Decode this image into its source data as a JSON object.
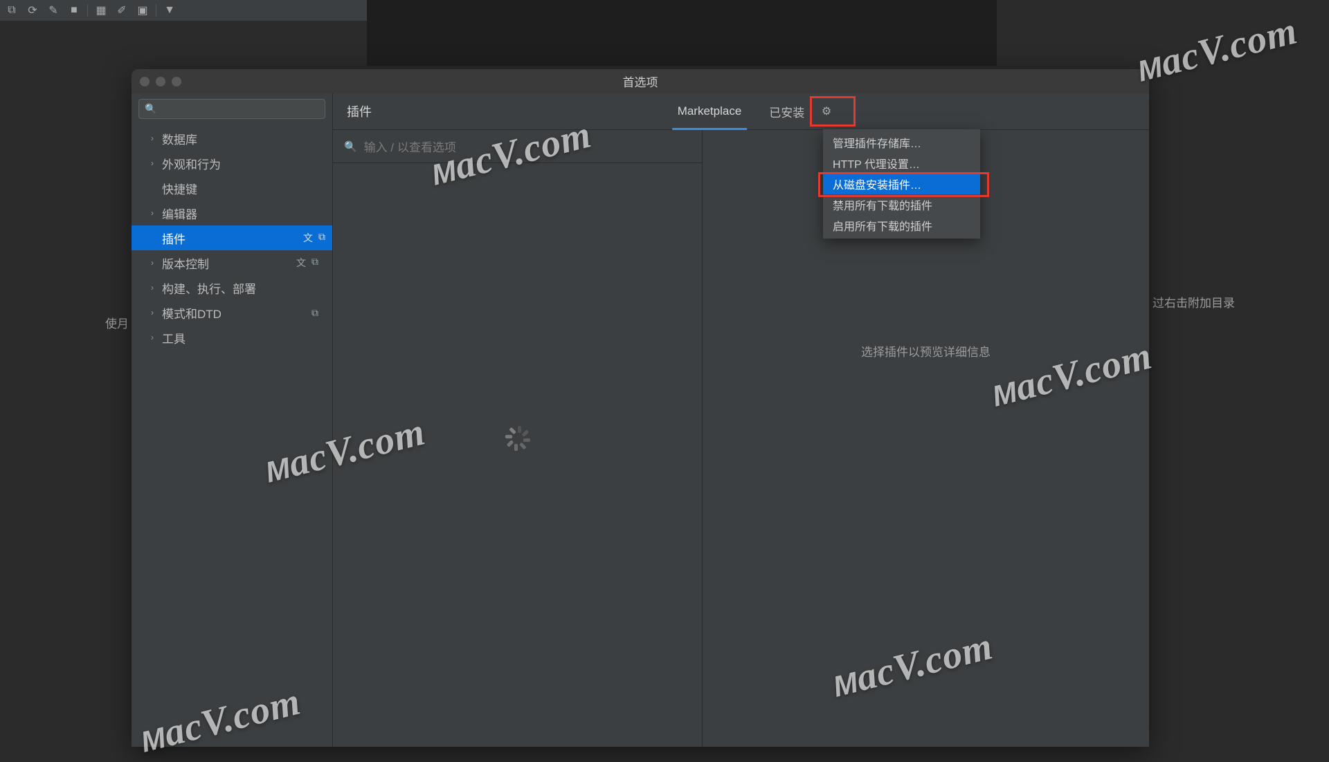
{
  "background": {
    "text_left": "使月",
    "text_right": "过右击附加目录"
  },
  "dialog": {
    "title": "首选项",
    "sidebar_search_placeholder": "",
    "sidebar": [
      {
        "label": "数据库",
        "chev": true
      },
      {
        "label": "外观和行为",
        "chev": true
      },
      {
        "label": "快捷键",
        "chev": false
      },
      {
        "label": "编辑器",
        "chev": true
      },
      {
        "label": "插件",
        "chev": false,
        "selected": true,
        "icons": true
      },
      {
        "label": "版本控制",
        "chev": true,
        "icons": true
      },
      {
        "label": "构建、执行、部署",
        "chev": true
      },
      {
        "label": "模式和DTD",
        "chev": true,
        "icons_single": true
      },
      {
        "label": "工具",
        "chev": true
      }
    ],
    "content_title": "插件",
    "tabs": {
      "marketplace": "Marketplace",
      "installed": "已安装"
    },
    "list_search_placeholder": "输入 / 以查看选项",
    "detail_placeholder": "选择插件以预览详细信息"
  },
  "menu": {
    "items": [
      "管理插件存储库…",
      "HTTP 代理设置…",
      "从磁盘安装插件…",
      "禁用所有下载的插件",
      "启用所有下载的插件"
    ],
    "highlighted_index": 2
  },
  "watermark_text": "MacV.com"
}
